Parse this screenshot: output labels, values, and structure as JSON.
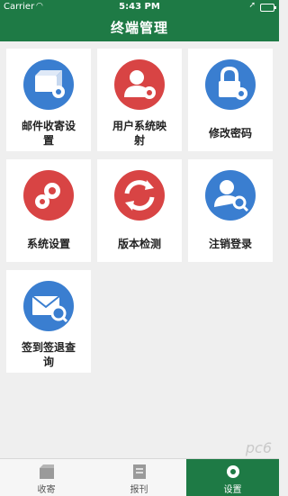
{
  "status_bar": {
    "carrier": "Carrier",
    "time": "5:43 PM"
  },
  "header": {
    "title": "终端管理"
  },
  "tiles": [
    {
      "label": "邮件收寄设置",
      "icon": "package-gear-icon",
      "color": "#3a7ed0"
    },
    {
      "label": "用户系统映射",
      "icon": "user-gear-icon",
      "color": "#d84444"
    },
    {
      "label": "修改密码",
      "icon": "lock-gear-icon",
      "color": "#3a7ed0"
    },
    {
      "label": "系统设置",
      "icon": "gears-icon",
      "color": "#d84444"
    },
    {
      "label": "版本检测",
      "icon": "refresh-icon",
      "color": "#d84444"
    },
    {
      "label": "注销登录",
      "icon": "user-search-icon",
      "color": "#3a7ed0"
    },
    {
      "label": "签到签退查询",
      "icon": "mail-search-icon",
      "color": "#3a7ed0"
    }
  ],
  "tabbar": [
    {
      "label": "收寄",
      "icon": "box-icon"
    },
    {
      "label": "报刊",
      "icon": "newspaper-icon"
    },
    {
      "label": "设置",
      "icon": "settings-icon",
      "active": true
    }
  ],
  "watermark": "pc6"
}
